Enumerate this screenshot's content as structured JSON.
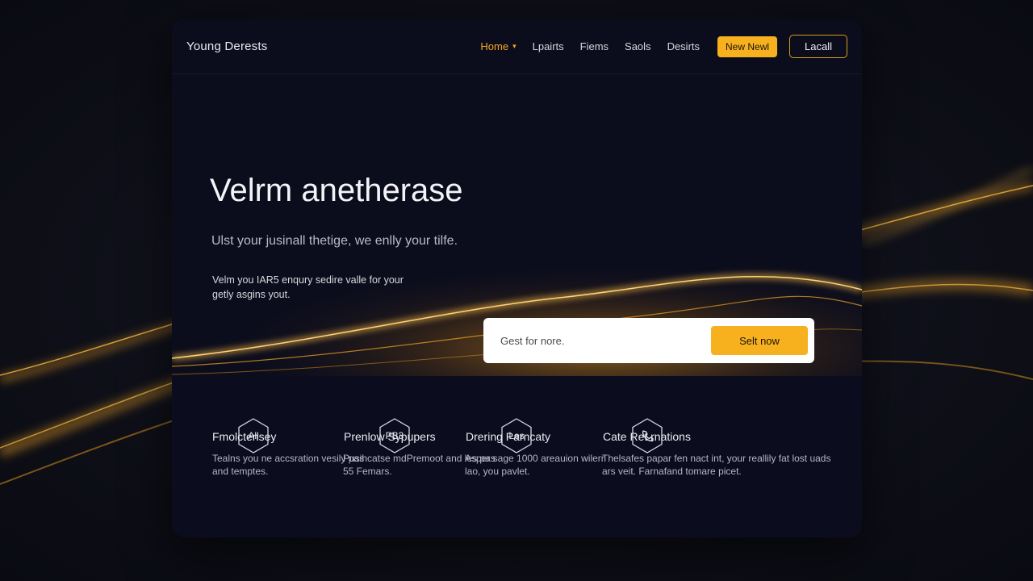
{
  "brand": "Young Derests",
  "nav": {
    "items": [
      {
        "label": "Home",
        "active": true,
        "has_dropdown": true
      },
      {
        "label": "Lpairts"
      },
      {
        "label": "Fiems"
      },
      {
        "label": "Saols"
      },
      {
        "label": "Desirts"
      }
    ],
    "primary_button": "New Newl",
    "outline_button": "Lacall"
  },
  "hero": {
    "title": "Velrm anetherase",
    "subtitle": "Ulst your jusinall thetige, we enlly your tilfe.",
    "description": "Velm you IAR5 enqury sedire valle for your getly asgins yout."
  },
  "cta": {
    "placeholder": "Gest for nore.",
    "button": "Selt now"
  },
  "features": [
    {
      "icon": "hexagon-text-icon",
      "icon_text": "All",
      "title": "Fmolctensey",
      "text": "Tealns you ne accsration vesily pas and temptes."
    },
    {
      "icon": "hexagon-text-icon",
      "icon_text": "PB3",
      "title": "Prenlow Sypupers",
      "text": "Pusihcatse mdPremoot and les pas 55 Femars."
    },
    {
      "icon": "hexagon-text-icon",
      "icon_text": "Les",
      "title": "Drering Parncaty",
      "text": "Asper sage 1000 areauion wilerr lao, you pavlet."
    },
    {
      "icon": "phone-icon",
      "icon_text": "",
      "title": "Cate Ret rnations",
      "text": "Thelsafes papar fen nact int, your reallily fat lost uads ars veit. Farnafand tomare picet."
    }
  ],
  "colors": {
    "accent": "#f7b11e",
    "nav_active": "#f5a623",
    "card_bg": "#0c0d1c",
    "page_bg": "#0d0e16"
  }
}
